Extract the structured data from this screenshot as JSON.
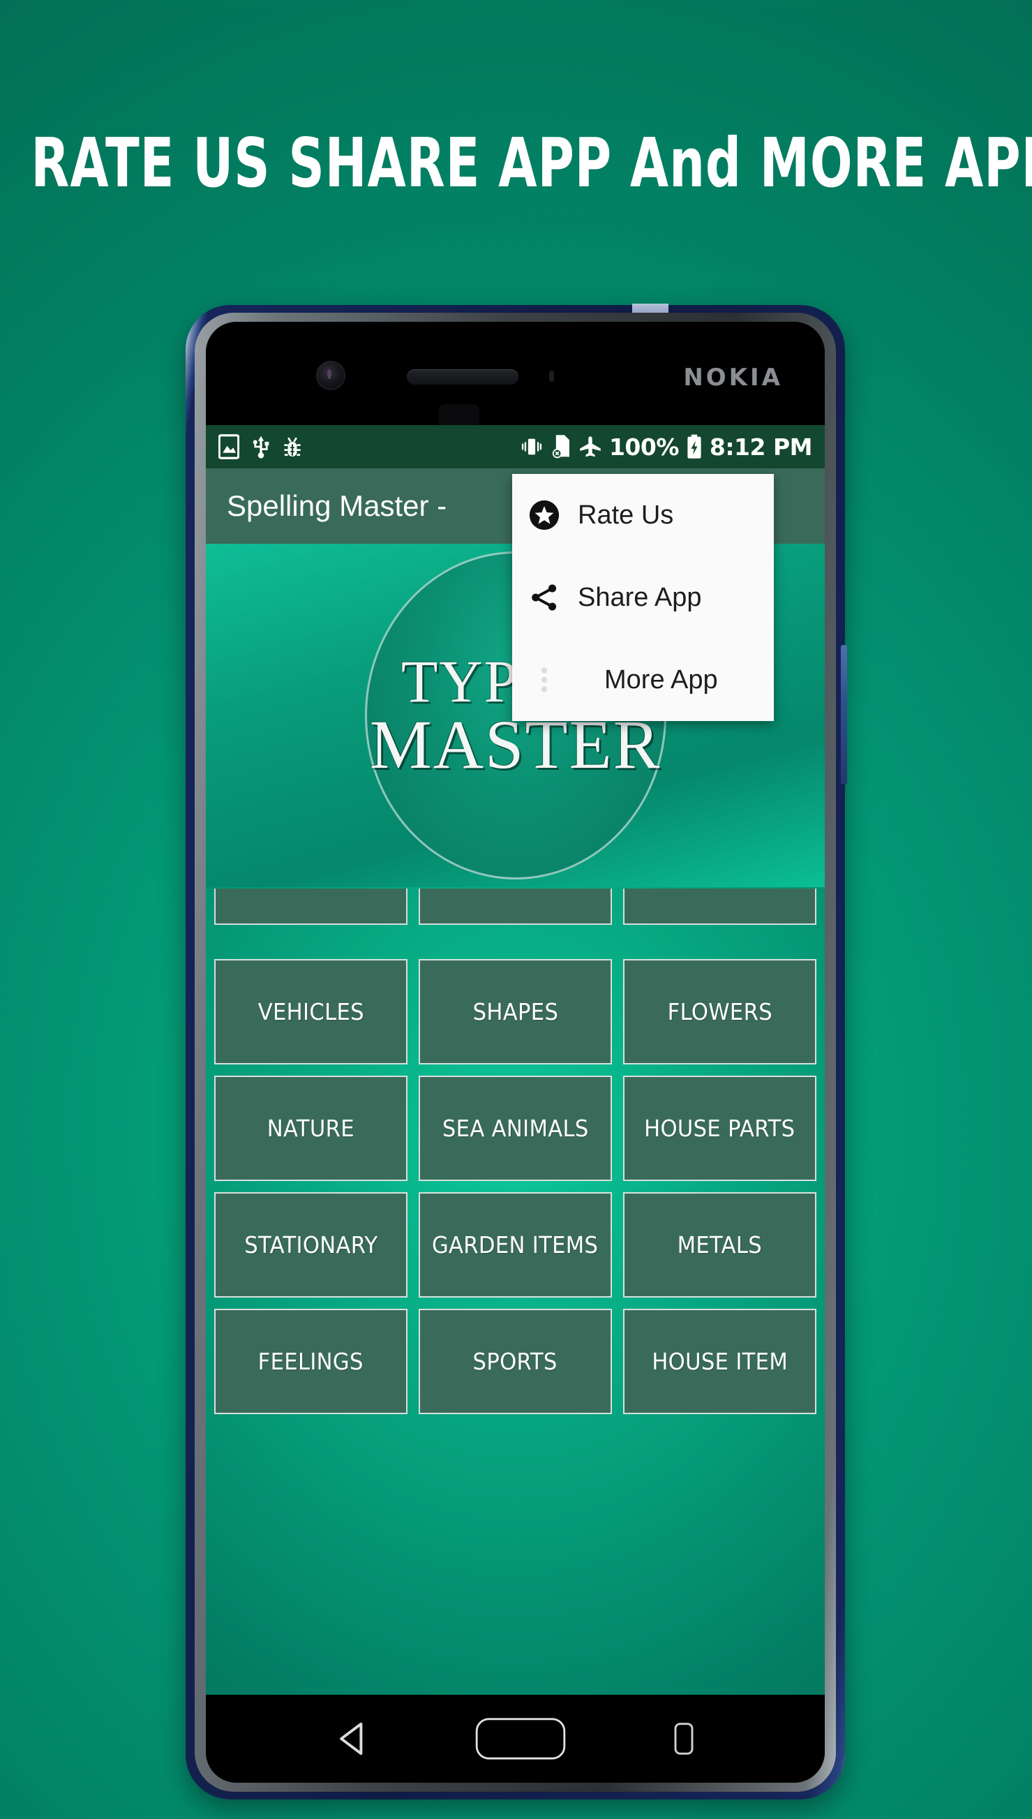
{
  "promo": {
    "headline": "RATE US SHARE APP And  MORE APP"
  },
  "device": {
    "brand_logo": "NOKIA",
    "hardware_icons": {
      "front_camera": "camera-icon",
      "earpiece": "speaker-icon",
      "proximity_sensor": "sensor-icon",
      "power_button": "power-button"
    }
  },
  "status_bar": {
    "left_icons": [
      "image-icon",
      "usb-icon",
      "bug-icon"
    ],
    "right_icons": [
      "vibrate-icon",
      "no-sim-icon",
      "airplane-mode-icon"
    ],
    "battery_percent": "100%",
    "battery_icon": "battery-charging-icon",
    "time": "8:12 PM",
    "background_color": "#13472f"
  },
  "app_bar": {
    "title": "Spelling Master -",
    "background_color": "#3a6b5a",
    "overflow_icon": "overflow-menu-icon"
  },
  "logo_banner": {
    "line1": "TYPING",
    "line2": "MASTER"
  },
  "overflow_menu": {
    "items": [
      {
        "label": "Rate Us",
        "icon": "star-circle-icon"
      },
      {
        "label": "Share App",
        "icon": "share-icon"
      },
      {
        "label": "More App",
        "icon": "vertical-dots-icon"
      }
    ],
    "background_color": "#fafafa"
  },
  "category_grid": {
    "partial_row_count": 3,
    "buttons": [
      "VEHICLES",
      "SHAPES",
      "FLOWERS",
      "NATURE",
      "SEA ANIMALS",
      "HOUSE PARTS",
      "STATIONARY",
      "GARDEN ITEMS",
      "METALS",
      "FEELINGS",
      "SPORTS",
      "HOUSE ITEM"
    ],
    "button_color": "#3a6b5a",
    "border_color": "#ffffff"
  },
  "nav_bar": {
    "buttons": [
      {
        "name": "back-button",
        "icon": "back-triangle-icon"
      },
      {
        "name": "home-button",
        "icon": "home-pill-icon"
      },
      {
        "name": "recents-button",
        "icon": "recents-square-icon"
      }
    ]
  },
  "theme": {
    "background_top": "#027659",
    "background_center": "#06b388",
    "accent_green": "#3a6b5a",
    "frame_blue": "#16255a"
  }
}
